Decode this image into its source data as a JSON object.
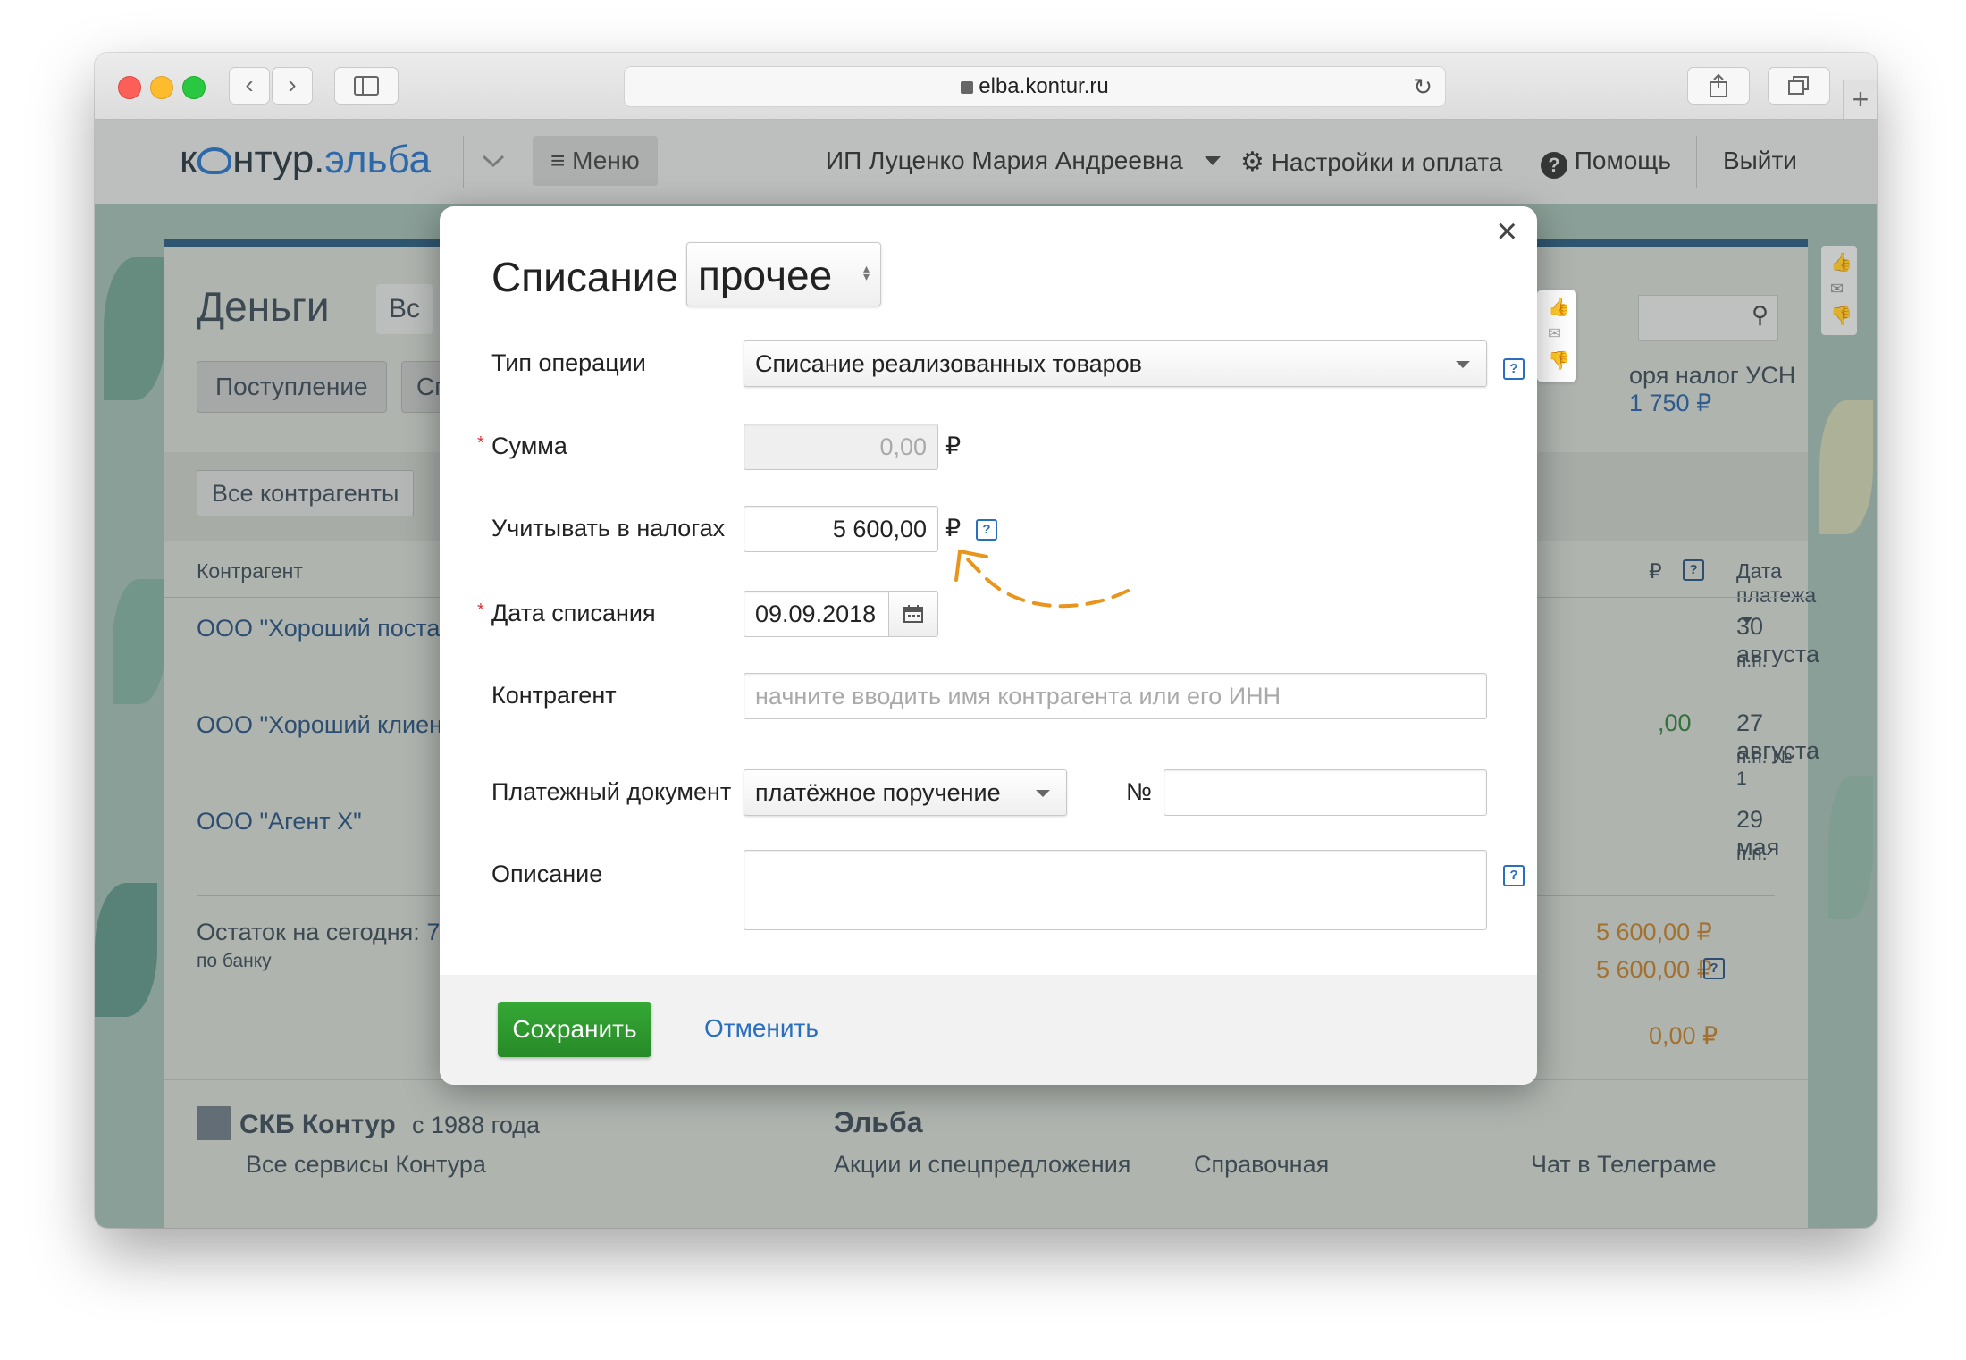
{
  "browser": {
    "url": "elba.kontur.ru"
  },
  "app": {
    "logo_prefix": "к",
    "logo_middle": "нтур.",
    "logo_suffix": "эльба",
    "menu_label": "Меню",
    "user_name": "ИП Луценко Мария Андреевна",
    "settings_label": "Настройки и оплата",
    "help_label": "Помощь",
    "logout_label": "Выйти"
  },
  "background_page": {
    "title": "Деньги",
    "tab_fragment": "Вс",
    "income_button": "Поступление",
    "second_button_fragment": "Сп",
    "tax_text": "оря налог УСН",
    "tax_amount": "1 750 ₽",
    "contractor_filter": "Все контрагенты",
    "column_contractor": "Контрагент",
    "column_currency": "₽",
    "column_payment_date": "Дата платежа",
    "rows": [
      {
        "name": "ООО \"Хороший поста",
        "date": "30 августа",
        "note": "п.п.",
        "amount": ""
      },
      {
        "name": "ООО \"Хороший клиен",
        "date": "27 августа",
        "note": "п.п. № 1",
        "amount": ",00"
      },
      {
        "name": "ООО \"Агент Х\"",
        "date": "29 мая",
        "note": "п.п.",
        "amount": ""
      }
    ],
    "balance_label": "Остаток на сегодня:",
    "balance_fragment": "7",
    "balance_sub": "по банку",
    "totals": [
      "5 600,00 ₽",
      "5 600,00 ₽",
      "0,00 ₽"
    ],
    "footer": {
      "company": "СКБ Контур",
      "since": "с 1988 года",
      "all_services": "Все сервисы Контура",
      "product": "Эльба",
      "promo": "Акции и спецпредложения",
      "reference": "Справочная",
      "telegram": "Чат в Телеграме"
    }
  },
  "modal": {
    "title": "Списание",
    "type_value": "прочее",
    "operation_type_label": "Тип операции",
    "operation_type_value": "Списание реализованных товаров",
    "amount_label": "Сумма",
    "amount_value": "0,00",
    "currency": "₽",
    "tax_label": "Учитывать в налогах",
    "tax_value": "5 600,00",
    "date_label": "Дата списания",
    "date_value": "09.09.2018",
    "contractor_label": "Контрагент",
    "contractor_placeholder": "начните вводить имя контрагента или его ИНН",
    "payment_doc_label": "Платежный документ",
    "payment_doc_value": "платёжное поручение",
    "number_label": "№",
    "number_value": "",
    "description_label": "Описание",
    "description_value": "",
    "save_label": "Сохранить",
    "cancel_label": "Отменить",
    "required_mark": "*",
    "help_mark": "?"
  },
  "colors": {
    "link": "#2a6fbf",
    "save_button": "#2e9b2e",
    "accent_orange": "#e8951e",
    "header_dark": "#2d5a7a"
  }
}
